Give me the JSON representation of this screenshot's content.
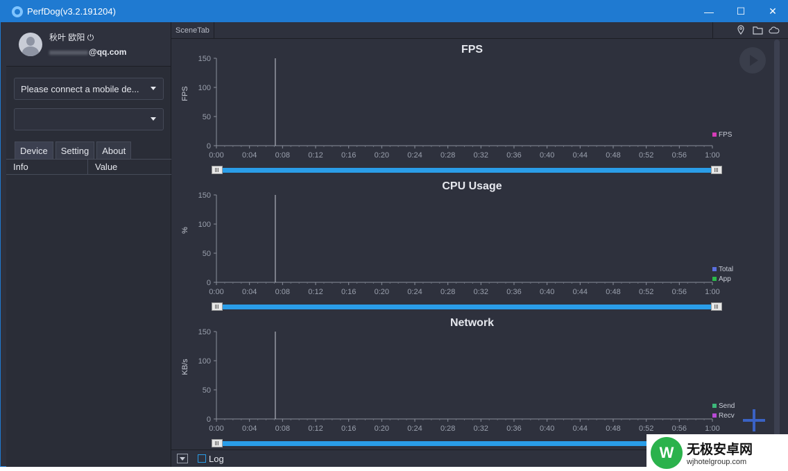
{
  "window": {
    "title": "PerfDog(v3.2.191204)",
    "controls": {
      "minimize": "—",
      "maximize": "☐",
      "close": "✕"
    }
  },
  "user": {
    "name": "秋叶 欧阳",
    "power_icon": "⏻",
    "email_suffix": "@qq.com"
  },
  "device_select": {
    "value": "Please connect a mobile de..."
  },
  "app_select": {
    "value": ""
  },
  "left_tabs": [
    {
      "label": "Device"
    },
    {
      "label": "Setting"
    },
    {
      "label": "About"
    }
  ],
  "info_table": {
    "columns": [
      "Info",
      "Value"
    ],
    "rows": []
  },
  "scene_tab": {
    "label": "SceneTab"
  },
  "top_icons": [
    "location-icon",
    "folder-icon",
    "cloud-icon"
  ],
  "chart_data": [
    {
      "type": "line",
      "title": "FPS",
      "ylabel": "FPS",
      "xlabel": "",
      "yticks": [
        0,
        50,
        100,
        150
      ],
      "ylim": [
        0,
        150
      ],
      "xticks": [
        "0:00",
        "0:04",
        "0:08",
        "0:12",
        "0:16",
        "0:20",
        "0:24",
        "0:28",
        "0:32",
        "0:36",
        "0:40",
        "0:44",
        "0:48",
        "0:52",
        "0:56",
        "1:00"
      ],
      "cursor_x": "0:07",
      "legend": [
        {
          "name": "FPS",
          "color": "#d63cb8"
        }
      ],
      "series": [
        {
          "name": "FPS",
          "values": []
        }
      ]
    },
    {
      "type": "line",
      "title": "CPU Usage",
      "ylabel": "%",
      "xlabel": "",
      "yticks": [
        0,
        50,
        100,
        150
      ],
      "ylim": [
        0,
        150
      ],
      "xticks": [
        "0:00",
        "0:04",
        "0:08",
        "0:12",
        "0:16",
        "0:20",
        "0:24",
        "0:28",
        "0:32",
        "0:36",
        "0:40",
        "0:44",
        "0:48",
        "0:52",
        "0:56",
        "1:00"
      ],
      "cursor_x": "0:07",
      "legend": [
        {
          "name": "Total",
          "color": "#5a6ee0"
        },
        {
          "name": "App",
          "color": "#2cb84a"
        }
      ],
      "series": [
        {
          "name": "Total",
          "values": []
        },
        {
          "name": "App",
          "values": []
        }
      ]
    },
    {
      "type": "line",
      "title": "Network",
      "ylabel": "KB/s",
      "xlabel": "",
      "yticks": [
        0,
        50,
        100,
        150
      ],
      "ylim": [
        0,
        150
      ],
      "xticks": [
        "0:00",
        "0:04",
        "0:08",
        "0:12",
        "0:16",
        "0:20",
        "0:24",
        "0:28",
        "0:32",
        "0:36",
        "0:40",
        "0:44",
        "0:48",
        "0:52",
        "0:56",
        "1:00"
      ],
      "cursor_x": "0:07",
      "legend": [
        {
          "name": "Send",
          "color": "#3cb87a"
        },
        {
          "name": "Recv",
          "color": "#b84ad6"
        }
      ],
      "series": [
        {
          "name": "Send",
          "values": []
        },
        {
          "name": "Recv",
          "values": []
        }
      ]
    }
  ],
  "bottom": {
    "log_label": "Log"
  },
  "watermark": {
    "logo": "W",
    "title": "无极安卓网",
    "url": "wjhotelgroup.com"
  }
}
